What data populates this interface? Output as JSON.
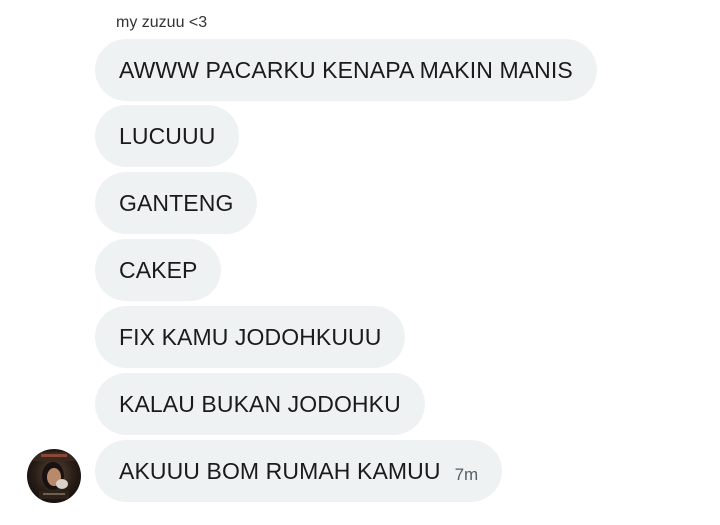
{
  "conversation": {
    "sender_name": "my zuzuu <3",
    "messages": [
      {
        "text": "AWWW PACARKU KENAPA MAKIN MANIS"
      },
      {
        "text": "LUCUUU"
      },
      {
        "text": "GANTENG"
      },
      {
        "text": "CAKEP"
      },
      {
        "text": "FIX KAMU JODOHKUUU"
      },
      {
        "text": "KALAU BUKAN JODOHKU"
      },
      {
        "text": "AKUUU BOM RUMAH KAMUU",
        "time": "7m"
      }
    ],
    "bubble_color": "#eff2f3",
    "text_color": "#1b1b1b",
    "timestamp_color": "#555f66"
  }
}
